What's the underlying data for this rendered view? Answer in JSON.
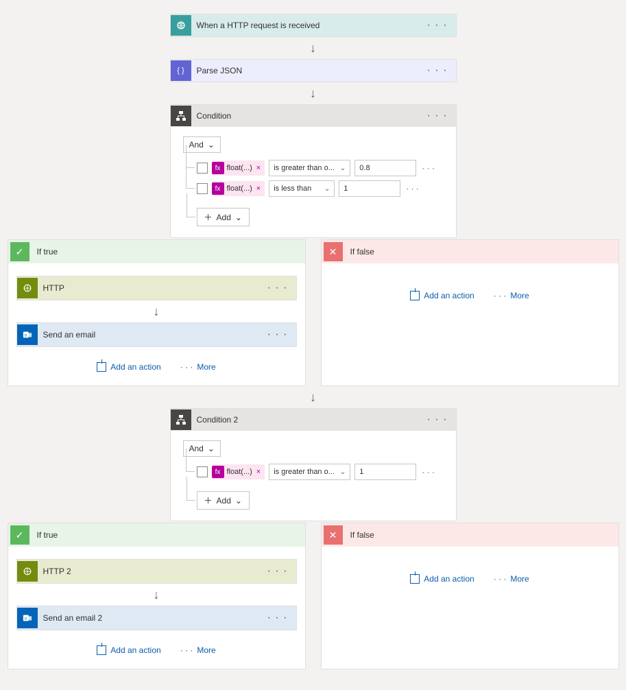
{
  "trigger": {
    "title": "When a HTTP request is received"
  },
  "parseJson": {
    "title": "Parse JSON"
  },
  "condition1": {
    "title": "Condition",
    "group": "And",
    "addLabel": "Add",
    "rules": [
      {
        "chip": "float(...)",
        "op": "is greater than o...",
        "value": "0.8"
      },
      {
        "chip": "float(...)",
        "op": "is less than",
        "value": "1"
      }
    ]
  },
  "branch1": {
    "trueLabel": "If true",
    "falseLabel": "If false",
    "http": {
      "title": "HTTP"
    },
    "email": {
      "title": "Send an email"
    }
  },
  "condition2": {
    "title": "Condition 2",
    "group": "And",
    "addLabel": "Add",
    "rules": [
      {
        "chip": "float(...)",
        "op": "is greater than o...",
        "value": "1"
      }
    ]
  },
  "branch2": {
    "trueLabel": "If true",
    "falseLabel": "If false",
    "http": {
      "title": "HTTP 2"
    },
    "email": {
      "title": "Send an email 2"
    }
  },
  "actions": {
    "add": "Add an action",
    "more": "More"
  },
  "glyphs": {
    "dots": "· · ·",
    "chev": "⌄",
    "plus": "＋",
    "check": "✓",
    "cross": "✕"
  }
}
